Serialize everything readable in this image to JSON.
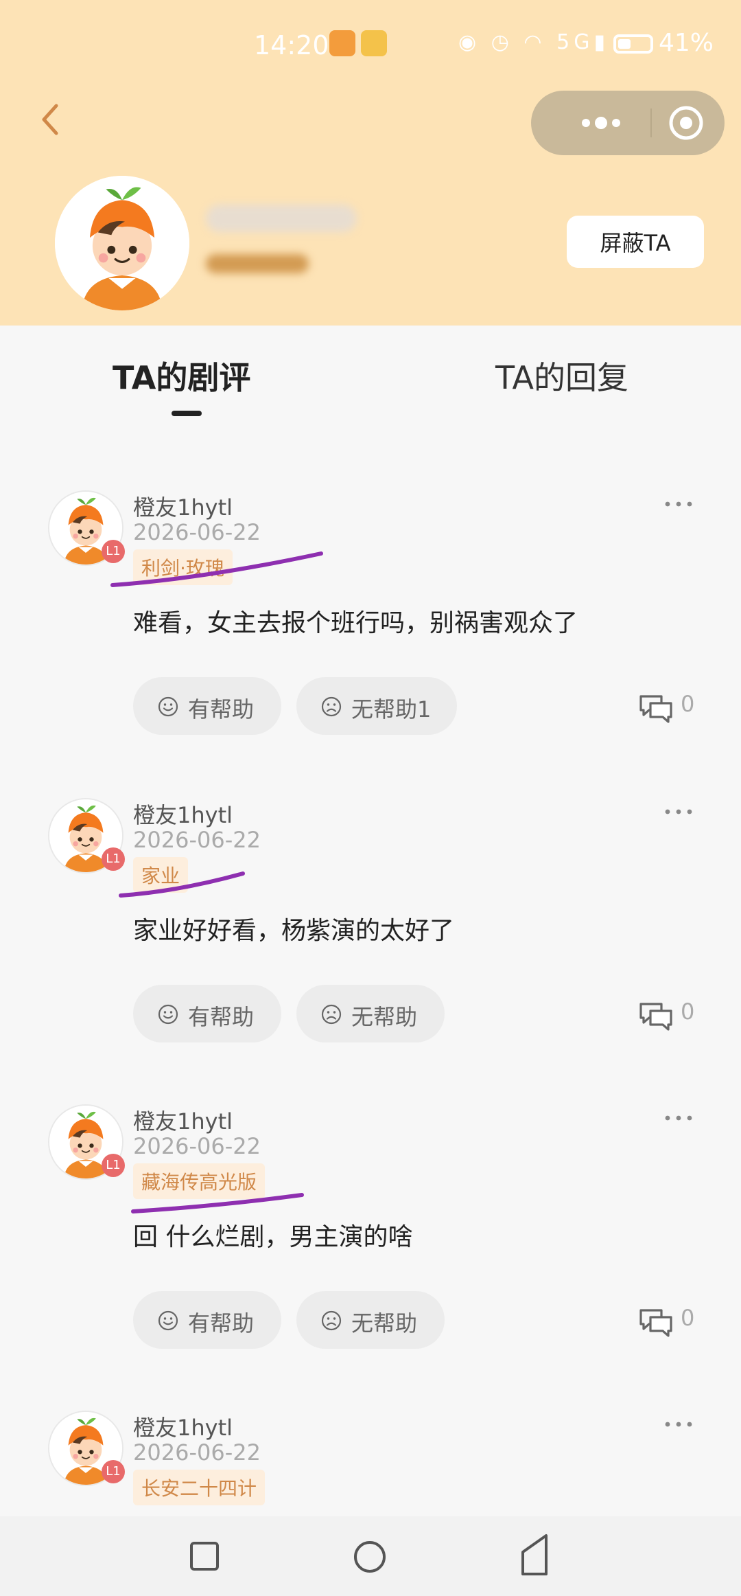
{
  "status_bar": {
    "time": "14:20",
    "signal": "5G",
    "battery_percent": "41%",
    "battery_level": 0.41
  },
  "header": {
    "block_button_label": "屏蔽TA",
    "back_icon": "chevron-left-icon",
    "more_icon": "more-dots-icon",
    "close_icon": "target-close-icon"
  },
  "tabs": [
    {
      "label": "TA的剧评",
      "active": true
    },
    {
      "label": "TA的回复",
      "active": false
    }
  ],
  "reviews": [
    {
      "username": "橙友1hytl",
      "date": "2026-06-22",
      "level": "L1",
      "show": "利剑·玫瑰",
      "text": "难看，女主去报个班行吗，别祸害观众了",
      "helpful_label": "有帮助",
      "unhelpful_label": "无帮助1",
      "comment_count": "0"
    },
    {
      "username": "橙友1hytl",
      "date": "2026-06-22",
      "level": "L1",
      "show": "家业",
      "text": "家业好好看，杨紫演的太好了",
      "helpful_label": "有帮助",
      "unhelpful_label": "无帮助",
      "comment_count": "0"
    },
    {
      "username": "橙友1hytl",
      "date": "2026-06-22",
      "level": "L1",
      "show": "藏海传高光版",
      "text": "回 什么烂剧，男主演的啥",
      "helpful_label": "有帮助",
      "unhelpful_label": "无帮助",
      "comment_count": "0"
    },
    {
      "username": "橙友1hytl",
      "date": "2026-06-22",
      "level": "L1",
      "show": "长安二十四计"
    }
  ],
  "colors": {
    "header_bg": "#fde3b6",
    "accent_orange": "#d08848",
    "highlight_purple": "#8e2fb0",
    "level_badge": "#e86a6a"
  }
}
